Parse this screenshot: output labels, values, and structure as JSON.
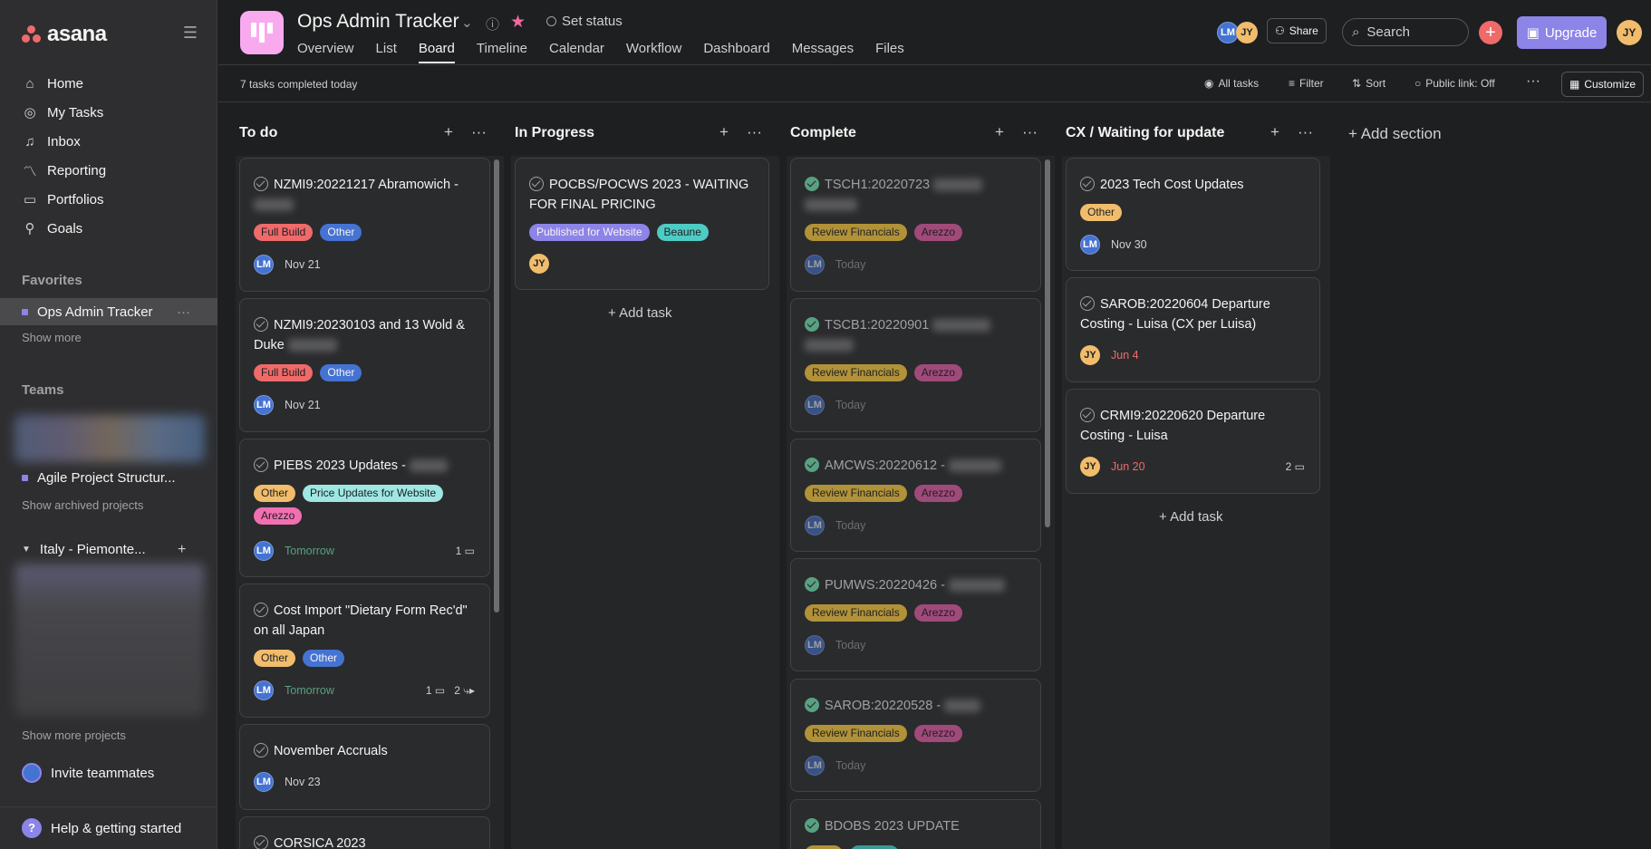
{
  "app": {
    "logo": "asana"
  },
  "sidebar": {
    "nav": [
      {
        "label": "Home",
        "icon": "home-icon"
      },
      {
        "label": "My Tasks",
        "icon": "check-circle-icon"
      },
      {
        "label": "Inbox",
        "icon": "bell-icon"
      },
      {
        "label": "Reporting",
        "icon": "chart-icon"
      },
      {
        "label": "Portfolios",
        "icon": "folder-icon"
      },
      {
        "label": "Goals",
        "icon": "person-icon"
      }
    ],
    "favorites_label": "Favorites",
    "favorite_item": "Ops Admin Tracker",
    "show_more": "Show more",
    "teams_label": "Teams",
    "team_project": "Agile Project Structur...",
    "show_archived": "Show archived projects",
    "team_group": "Italy - Piemonte...",
    "show_more_projects": "Show more projects",
    "invite": "Invite teammates",
    "help": "Help & getting started"
  },
  "header": {
    "title": "Ops Admin Tracker",
    "set_status": "Set status",
    "tabs": [
      "Overview",
      "List",
      "Board",
      "Timeline",
      "Calendar",
      "Workflow",
      "Dashboard",
      "Messages",
      "Files"
    ],
    "active_tab": "Board",
    "avatars": [
      "LM",
      "JY"
    ],
    "share": "Share",
    "search_placeholder": "Search",
    "upgrade": "Upgrade",
    "user": "JY"
  },
  "toolbar": {
    "completed": "7 tasks completed today",
    "all_tasks": "All tasks",
    "filter": "Filter",
    "sort": "Sort",
    "public_link": "Public link: Off",
    "customize": "Customize"
  },
  "board": {
    "add_section": "Add section",
    "add_task": "Add task",
    "columns": [
      {
        "title": "To do",
        "cards": [
          {
            "title": "NZMI9:20221217 Abramowich -",
            "tags": [
              "Full Build",
              "Other"
            ],
            "assignee": "LM",
            "due": "Nov 21"
          },
          {
            "title": "NZMI9:20230103 and 13 Wold & Duke",
            "tags": [
              "Full Build",
              "Other"
            ],
            "assignee": "LM",
            "due": "Nov 21"
          },
          {
            "title": "PIEBS 2023 Updates -",
            "tags": [
              "Other",
              "Price Updates for Website",
              "Arezzo"
            ],
            "assignee": "LM",
            "due": "Tomorrow",
            "comments": "1"
          },
          {
            "title": "Cost Import \"Dietary Form Rec'd\" on all Japan",
            "tags": [
              "Other",
              "Other"
            ],
            "assignee": "LM",
            "due": "Tomorrow",
            "comments": "1",
            "subtasks": "2"
          },
          {
            "title": "November Accruals",
            "tags": [],
            "assignee": "LM",
            "due": "Nov 23"
          },
          {
            "title": "CORSICA 2023",
            "tags": []
          }
        ]
      },
      {
        "title": "In Progress",
        "cards": [
          {
            "title": "POCBS/POCWS 2023 - WAITING FOR FINAL PRICING",
            "tags": [
              "Published for Website",
              "Beaune"
            ],
            "assignee": "JY"
          }
        ]
      },
      {
        "title": "Complete",
        "cards": [
          {
            "title": "TSCH1:20220723",
            "tags": [
              "Review Financials",
              "Arezzo"
            ],
            "assignee": "LM",
            "due": "Today"
          },
          {
            "title": "TSCB1:20220901",
            "tags": [
              "Review Financials",
              "Arezzo"
            ],
            "assignee": "LM",
            "due": "Today"
          },
          {
            "title": "AMCWS:20220612 -",
            "tags": [
              "Review Financials",
              "Arezzo"
            ],
            "assignee": "LM",
            "due": "Today"
          },
          {
            "title": "PUMWS:20220426 -",
            "tags": [
              "Review Financials",
              "Arezzo"
            ],
            "assignee": "LM",
            "due": "Today"
          },
          {
            "title": "SAROB:20220528 -",
            "tags": [
              "Review Financials",
              "Arezzo"
            ],
            "assignee": "LM",
            "due": "Today"
          },
          {
            "title": "BDOBS 2023 UPDATE",
            "tags": []
          }
        ]
      },
      {
        "title": "CX / Waiting for update",
        "cards": [
          {
            "title": "2023 Tech Cost Updates",
            "tags": [
              "Other"
            ],
            "assignee": "LM",
            "due": "Nov 30"
          },
          {
            "title": "SAROB:20220604 Departure Costing - Luisa (CX per Luisa)",
            "tags": [],
            "assignee": "JY",
            "due": "Jun 4"
          },
          {
            "title": "CRMI9:20220620 Departure Costing - Luisa",
            "tags": [],
            "assignee": "JY",
            "due": "Jun 20",
            "comments": "2"
          }
        ]
      }
    ]
  }
}
